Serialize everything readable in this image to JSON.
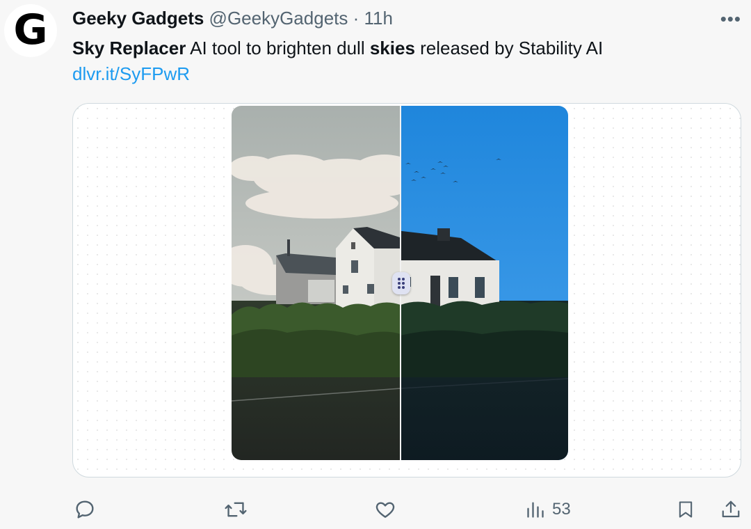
{
  "tweet": {
    "avatar_letter": "G",
    "author_name": "Geeky Gadgets",
    "handle": "@GeekyGadgets",
    "separator": "·",
    "time": "11h",
    "more_label": "•••",
    "text_parts": {
      "bold1": "Sky Replacer",
      "plain1": " AI tool to brighten dull ",
      "bold2": "skies",
      "plain2": " released by Stability AI"
    },
    "link": "dlvr.it/SyFPwR"
  },
  "actions": {
    "reply_icon": "reply-icon",
    "retweet_icon": "retweet-icon",
    "like_icon": "heart-icon",
    "views_icon": "views-bar-chart-icon",
    "views_count": "53",
    "bookmark_icon": "bookmark-icon",
    "share_icon": "share-icon"
  },
  "colors": {
    "link": "#1d9bf0",
    "muted": "#536471",
    "sky_after": "#2f8fe0"
  }
}
